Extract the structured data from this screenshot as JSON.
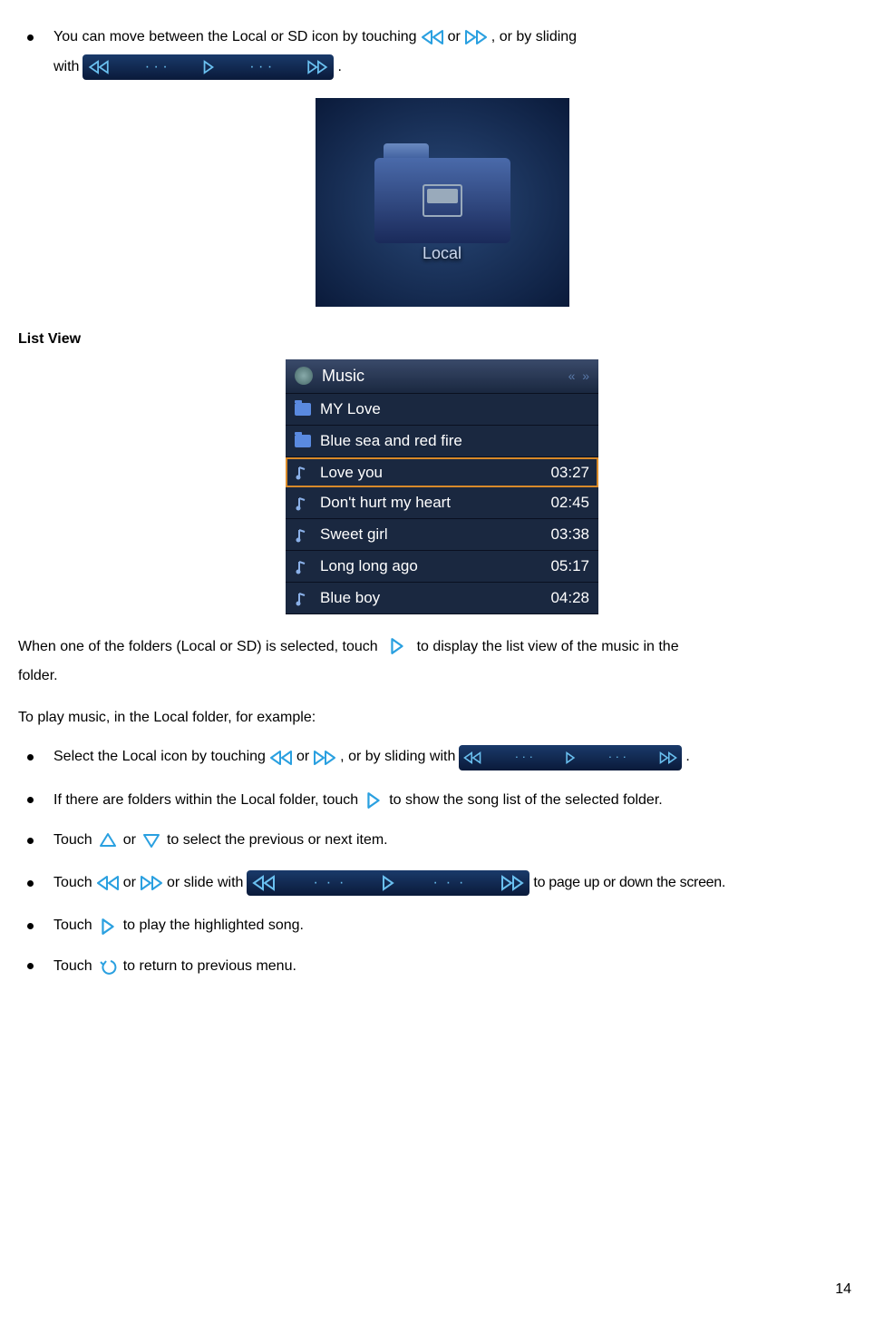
{
  "bullet1": {
    "text1": "You can move between the Local or SD icon by touching",
    "text2": "or",
    "text3": ", or by sliding",
    "text4": "with",
    "text5": "."
  },
  "folder_view": {
    "label": "Local"
  },
  "section_list_view": "List View",
  "music_list": {
    "header": "Music",
    "rows": [
      {
        "type": "folder",
        "name": "MY Love",
        "dur": ""
      },
      {
        "type": "folder",
        "name": "Blue sea and red fire",
        "dur": ""
      },
      {
        "type": "song",
        "name": "Love you",
        "dur": "03:27",
        "selected": true
      },
      {
        "type": "song",
        "name": "Don't hurt my heart",
        "dur": "02:45"
      },
      {
        "type": "song",
        "name": "Sweet girl",
        "dur": "03:38"
      },
      {
        "type": "song",
        "name": "Long long ago",
        "dur": "05:17"
      },
      {
        "type": "song",
        "name": "Blue boy",
        "dur": "04:28"
      }
    ]
  },
  "para1_a": "When one of the folders (Local or SD) is selected, touch",
  "para1_b": "to display the list view of the music in the",
  "para1_c": "folder.",
  "para2": "To play music, in the Local folder, for example:",
  "b2": {
    "a": "Select the Local icon by touching",
    "b": "or",
    "c": ", or by sliding with",
    "d": "."
  },
  "b3": {
    "a": "If there are folders within the Local folder, touch",
    "b": "to show the song list of the selected folder."
  },
  "b4": {
    "a": "Touch",
    "b": "or",
    "c": "to select the previous or next item."
  },
  "b5": {
    "a": "Touch",
    "b": "or",
    "c": "or slide with",
    "d": "to page up or down the screen."
  },
  "b6": {
    "a": "Touch",
    "b": "to play the highlighted song."
  },
  "b7": {
    "a": "Touch",
    "b": "to return to previous menu."
  },
  "page_number": "14"
}
